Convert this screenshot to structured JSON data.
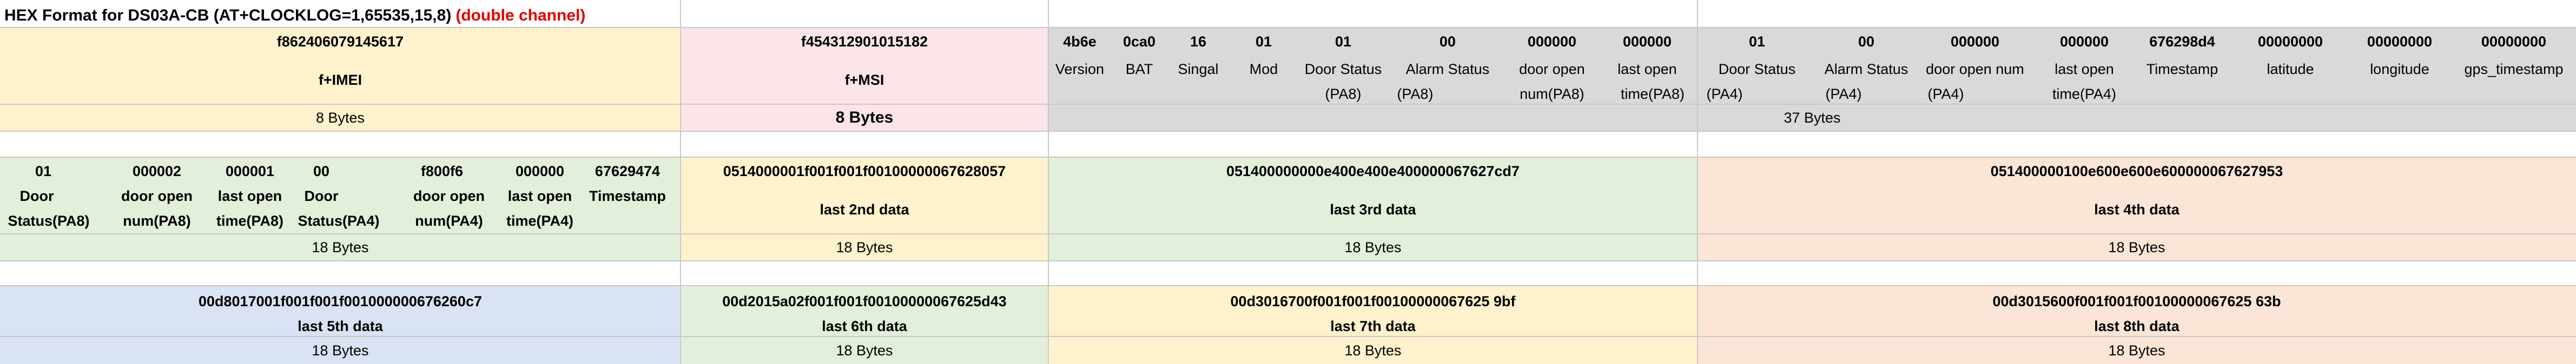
{
  "title": {
    "main": "HEX Format for DS03A-CB (AT+CLOCKLOG=1,65535,15,8)",
    "highlight": "(double channel)",
    "highlight_color": "#e00000"
  },
  "colors": {
    "yellow": "#fff2cc",
    "pink": "#fce4e8",
    "gray": "#d9d9d9",
    "green": "#e2efda",
    "peach": "#fbe5d6",
    "blue": "#dae3f3",
    "grid": "#c8c8c8"
  },
  "row1": {
    "imei": {
      "hex": "f862406079145617",
      "label": "f+IMEI",
      "size": "8 Bytes"
    },
    "imsi": {
      "hex": "f454312901015182",
      "label": "f+MSI",
      "size": "8 Bytes"
    },
    "fields": [
      {
        "hex": "4b6e",
        "line1": "Version",
        "line2": ""
      },
      {
        "hex": "0ca0",
        "line1": "BAT",
        "line2": ""
      },
      {
        "hex": "16",
        "line1": "Singal",
        "line2": ""
      },
      {
        "hex": "01",
        "line1": "Mod",
        "line2": ""
      },
      {
        "hex": "01",
        "line1": "Door Status",
        "line2": "(PA8)"
      },
      {
        "hex": "00",
        "line1": "Alarm Status",
        "line2": "(PA8)"
      },
      {
        "hex": "000000",
        "line1": "door open",
        "line2": "num(PA8)"
      },
      {
        "hex": "000000",
        "line1": "last open",
        "line2": "time(PA8)"
      },
      {
        "hex": "01",
        "line1": "Door Status",
        "line2": "(PA4)"
      },
      {
        "hex": "00",
        "line1": "Alarm Status",
        "line2": "(PA4)"
      },
      {
        "hex": "000000",
        "line1": "door open num",
        "line2": "(PA4)"
      },
      {
        "hex": "000000",
        "line1": "last open",
        "line2": "time(PA4)"
      },
      {
        "hex": "676298d4",
        "line1": "Timestamp",
        "line2": ""
      },
      {
        "hex": "00000000",
        "line1": "latitude",
        "line2": ""
      },
      {
        "hex": "00000000",
        "line1": "longitude",
        "line2": ""
      },
      {
        "hex": "00000000",
        "line1": "gps_timestamp",
        "line2": ""
      }
    ],
    "fields_size": "37 Bytes"
  },
  "row2": {
    "first": {
      "fields": [
        {
          "hex": "01",
          "line1": "Door",
          "line2": "Status(PA8)"
        },
        {
          "hex": "000002",
          "line1": "door open",
          "line2": "num(PA8)"
        },
        {
          "hex": "000001",
          "line1": "last open",
          "line2": "time(PA8)"
        },
        {
          "hex": "00",
          "line1": "Door",
          "line2": "Status(PA4)"
        },
        {
          "hex": "f800f6",
          "line1": "door open",
          "line2": "num(PA4)"
        },
        {
          "hex": "000000",
          "line1": "last open",
          "line2": "time(PA4)"
        },
        {
          "hex": "67629474",
          "line1": "Timestamp",
          "line2": ""
        }
      ],
      "size": "18 Bytes"
    },
    "blocks": [
      {
        "hex": "0514000001f001f001f00100000067628057",
        "label": "last 2nd data",
        "size": "18 Bytes"
      },
      {
        "hex": "051400000000e400e400e400000067627cd7",
        "label": "last 3rd data",
        "size": "18 Bytes"
      },
      {
        "hex": "051400000100e600e600e600000067627953",
        "label": "last 4th data",
        "size": "18 Bytes"
      }
    ]
  },
  "row3": {
    "blocks": [
      {
        "hex": "00d8017001f001f001f001000000676260c7",
        "label": "last 5th data",
        "size": "18 Bytes"
      },
      {
        "hex": "00d2015a02f001f001f00100000067625d43",
        "label": "last 6th data",
        "size": "18 Bytes"
      },
      {
        "hex": "00d3016700f001f001f00100000067625 9bf",
        "label": "last 7th data",
        "size": "18 Bytes"
      },
      {
        "hex": "00d3015600f001f001f00100000067625 63b",
        "label": "last 8th data",
        "size": "18 Bytes"
      }
    ]
  }
}
